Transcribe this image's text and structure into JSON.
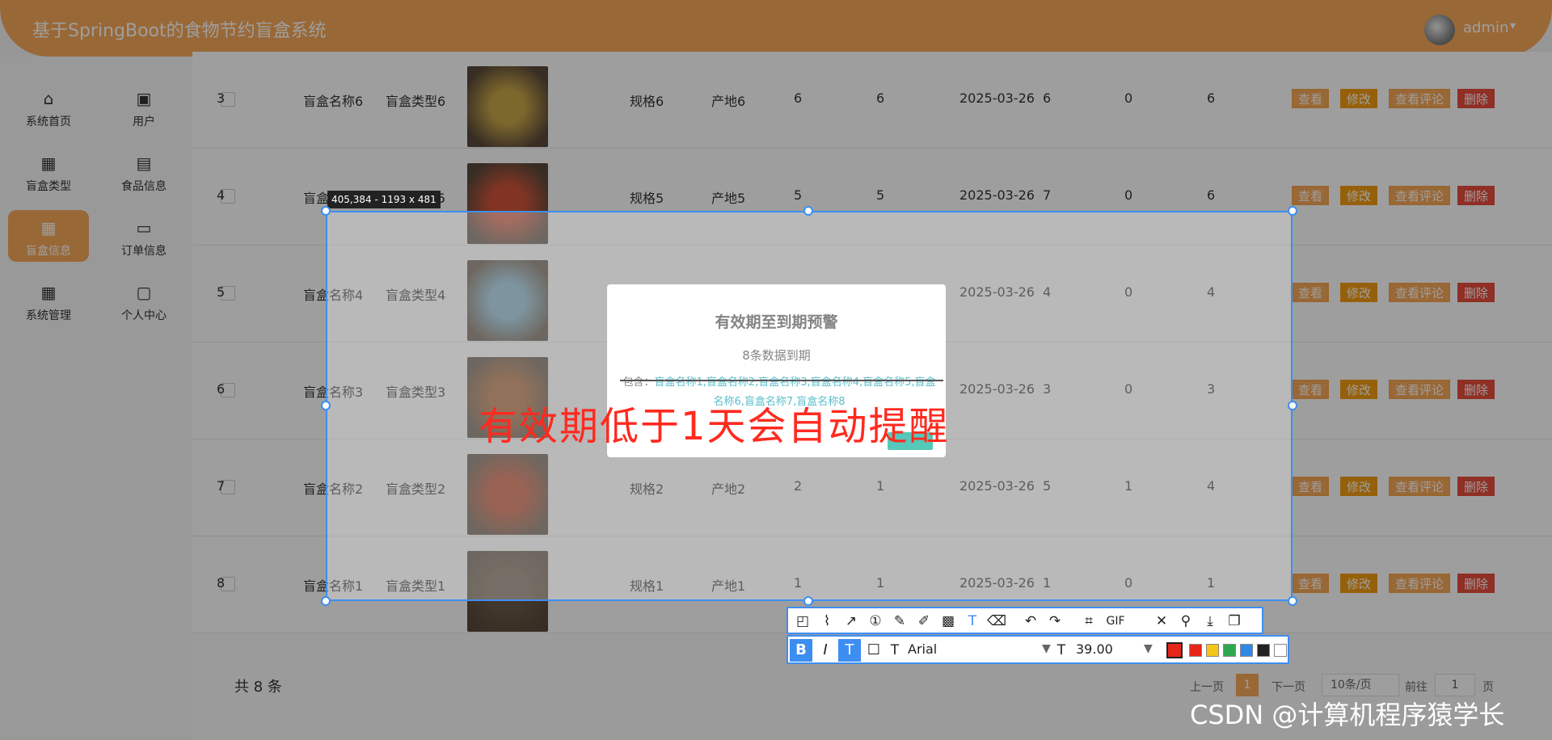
{
  "app": {
    "title": "基于SpringBoot的食物节约盲盒系统",
    "username": "admin"
  },
  "sidebar": {
    "items": [
      {
        "label": "系统首页",
        "icon": "home-icon"
      },
      {
        "label": "用户",
        "icon": "briefcase-icon"
      },
      {
        "label": "盲盒类型",
        "icon": "grid-icon"
      },
      {
        "label": "食品信息",
        "icon": "clipboard-icon"
      },
      {
        "label": "盲盒信息",
        "icon": "grid-icon"
      },
      {
        "label": "订单信息",
        "icon": "wallet-icon"
      },
      {
        "label": "系统管理",
        "icon": "grid-icon"
      },
      {
        "label": "个人中心",
        "icon": "card-icon"
      }
    ]
  },
  "table": {
    "rows": [
      {
        "idx": "3",
        "name": "盲盒名称6",
        "type": "盲盒类型6",
        "spec": "规格6",
        "origin": "产地6",
        "a": "6",
        "b": "6",
        "date": "2025-03-26",
        "c": "6",
        "d": "0",
        "e": "6"
      },
      {
        "idx": "4",
        "name": "盲盒名称5",
        "type": "盲盒类型5",
        "spec": "规格5",
        "origin": "产地5",
        "a": "5",
        "b": "5",
        "date": "2025-03-26",
        "c": "7",
        "d": "0",
        "e": "6"
      },
      {
        "idx": "5",
        "name": "盲盒名称4",
        "type": "盲盒类型4",
        "spec": "",
        "origin": "",
        "a": "",
        "b": "",
        "date": "2025-03-26",
        "c": "4",
        "d": "0",
        "e": "4"
      },
      {
        "idx": "6",
        "name": "盲盒名称3",
        "type": "盲盒类型3",
        "spec": "",
        "origin": "",
        "a": "",
        "b": "",
        "date": "2025-03-26",
        "c": "3",
        "d": "0",
        "e": "3"
      },
      {
        "idx": "7",
        "name": "盲盒名称2",
        "type": "盲盒类型2",
        "spec": "规格2",
        "origin": "产地2",
        "a": "2",
        "b": "1",
        "date": "2025-03-26",
        "c": "5",
        "d": "1",
        "e": "4"
      },
      {
        "idx": "8",
        "name": "盲盒名称1",
        "type": "盲盒类型1",
        "spec": "规格1",
        "origin": "产地1",
        "a": "1",
        "b": "1",
        "date": "2025-03-26",
        "c": "1",
        "d": "0",
        "e": "1"
      }
    ],
    "actions": {
      "view": "查看",
      "edit": "修改",
      "comments": "查看评论",
      "delete": "删除"
    }
  },
  "pager": {
    "total": "共 8 条",
    "prev": "上一页",
    "current": "1",
    "next": "下一页",
    "page_size": "10条/页",
    "goto_label": "前往",
    "goto_value": "1",
    "page_unit": "页"
  },
  "modal": {
    "title": "有效期至到期预警",
    "subtitle": "8条数据到期",
    "include_label": "包含：",
    "names": "盲盒名称1,盲盒名称2,盲盒名称3,盲盒名称4,盲盒名称5,盲盒名称6,盲盒名称7,盲盒名称8"
  },
  "screenshot_tool": {
    "size_label": "405,384 - 1193 x 481",
    "gif_label": "GIF",
    "font_name": "Arial",
    "font_size": "39.00",
    "current_color": "#e8251a",
    "palette": [
      "#e8251a",
      "#f5c518",
      "#2ea84e",
      "#2e8ae6",
      "#222222",
      "#ffffff"
    ]
  },
  "annotation_text": "有效期低于1天会自动提醒",
  "watermark": "CSDN @计算机程序猿学长"
}
